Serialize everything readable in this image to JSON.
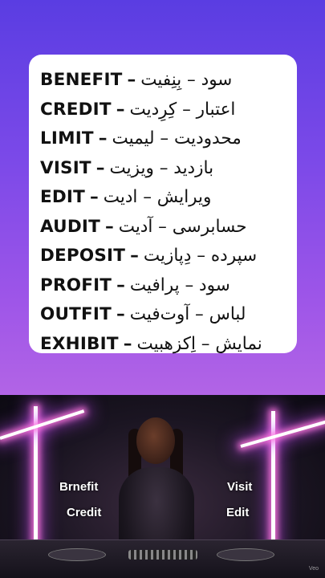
{
  "vocab": [
    {
      "en": "BENEFIT",
      "sep": "–",
      "fa": "سود – بِنِفیت"
    },
    {
      "en": "CREDIT",
      "sep": "–",
      "fa": "اعتبار – کِرِدیت"
    },
    {
      "en": "LIMIT",
      "sep": "–",
      "fa": "محدودیت – لیمیت"
    },
    {
      "en": "VISIT",
      "sep": "–",
      "fa": "بازدید – ویزیت"
    },
    {
      "en": "EDIT",
      "sep": "–",
      "fa": "ویرایش – ادیت"
    },
    {
      "en": "AUDIT",
      "sep": "–",
      "fa": "حسابرسی – آدیت"
    },
    {
      "en": "DEPOSIT",
      "sep": "–",
      "fa": "سپرده – دِپازیت"
    },
    {
      "en": "PROFIT",
      "sep": "–",
      "fa": "سود – پرافیت"
    },
    {
      "en": "OUTFIT",
      "sep": "–",
      "fa": "لباس – آوت‌فیت"
    },
    {
      "en": "EXHIBIT",
      "sep": "–",
      "fa": "نمایش – اِکزهبیت"
    }
  ],
  "video": {
    "label_left_top": "Brnefit",
    "label_left_bottom": "Credit",
    "label_right_top": "Visit",
    "label_right_bottom": "Edit",
    "watermark": "Veo"
  }
}
